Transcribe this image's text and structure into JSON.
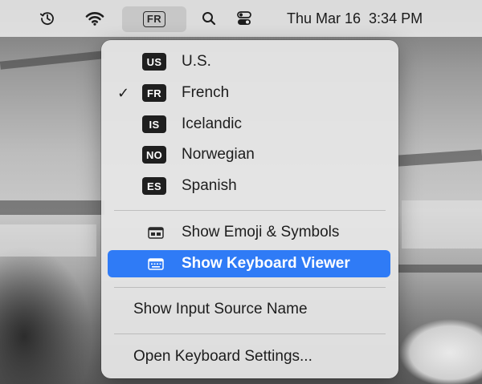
{
  "menubar": {
    "time_machine_icon": "time-machine-icon",
    "wifi_icon": "wifi-icon",
    "input_source": "FR",
    "search_icon": "search-icon",
    "control_center_icon": "control-center-icon",
    "date": "Thu Mar 16",
    "time": "3:34 PM"
  },
  "menu": {
    "input_sources": [
      {
        "code": "US",
        "label": "U.S.",
        "selected": false
      },
      {
        "code": "FR",
        "label": "French",
        "selected": true
      },
      {
        "code": "IS",
        "label": "Icelandic",
        "selected": false
      },
      {
        "code": "NO",
        "label": "Norwegian",
        "selected": false
      },
      {
        "code": "ES",
        "label": "Spanish",
        "selected": false
      }
    ],
    "checkmark": "✓",
    "emoji_label": "Show Emoji & Symbols",
    "keyboard_viewer_label": "Show Keyboard Viewer",
    "input_source_name_label": "Show Input Source Name",
    "keyboard_settings_label": "Open Keyboard Settings...",
    "highlight_color": "#2f7bf6"
  }
}
